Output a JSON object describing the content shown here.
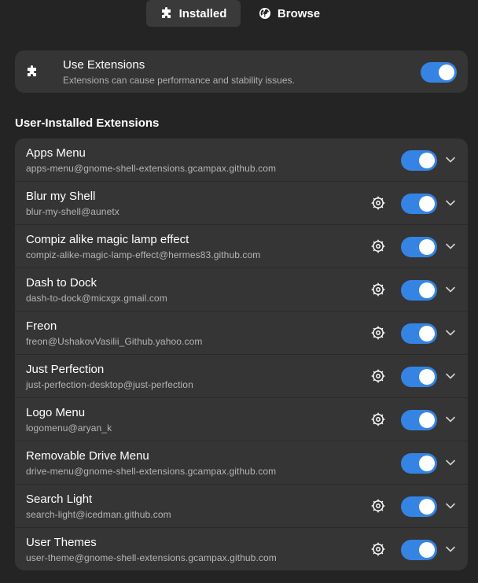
{
  "tabs": [
    {
      "label": "Installed",
      "icon": "puzzle-icon",
      "active": true
    },
    {
      "label": "Browse",
      "icon": "globe-icon",
      "active": false
    }
  ],
  "use_extensions": {
    "title": "Use Extensions",
    "subtitle": "Extensions can cause performance and stability issues.",
    "enabled": true
  },
  "section_title": "User-Installed Extensions",
  "extensions": [
    {
      "name": "Apps Menu",
      "uuid": "apps-menu@gnome-shell-extensions.gcampax.github.com",
      "has_settings": false,
      "enabled": true
    },
    {
      "name": "Blur my Shell",
      "uuid": "blur-my-shell@aunetx",
      "has_settings": true,
      "enabled": true
    },
    {
      "name": "Compiz alike magic lamp effect",
      "uuid": "compiz-alike-magic-lamp-effect@hermes83.github.com",
      "has_settings": true,
      "enabled": true
    },
    {
      "name": "Dash to Dock",
      "uuid": "dash-to-dock@micxgx.gmail.com",
      "has_settings": true,
      "enabled": true
    },
    {
      "name": "Freon",
      "uuid": "freon@UshakovVasilii_Github.yahoo.com",
      "has_settings": true,
      "enabled": true
    },
    {
      "name": "Just Perfection",
      "uuid": "just-perfection-desktop@just-perfection",
      "has_settings": true,
      "enabled": true
    },
    {
      "name": "Logo Menu",
      "uuid": "logomenu@aryan_k",
      "has_settings": true,
      "enabled": true
    },
    {
      "name": "Removable Drive Menu",
      "uuid": "drive-menu@gnome-shell-extensions.gcampax.github.com",
      "has_settings": false,
      "enabled": true
    },
    {
      "name": "Search Light",
      "uuid": "search-light@icedman.github.com",
      "has_settings": true,
      "enabled": true
    },
    {
      "name": "User Themes",
      "uuid": "user-theme@gnome-shell-extensions.gcampax.github.com",
      "has_settings": true,
      "enabled": true
    }
  ],
  "colors": {
    "background": "#242424",
    "card": "#353535",
    "accent": "#3584e4"
  }
}
